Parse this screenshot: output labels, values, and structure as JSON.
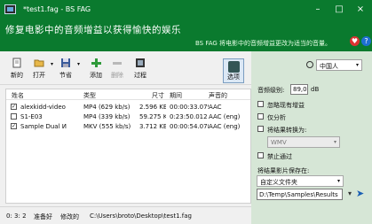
{
  "window": {
    "title": "*test1.fag - BS FAG",
    "slogan": "修复电影中的音频增益以获得愉快的娱乐",
    "hint": "BS FAG 将电影中的音频增益更改为适当的音量。",
    "controls": [
      "–",
      "□",
      "×"
    ]
  },
  "toolbar": {
    "buttons": [
      {
        "label": "新的",
        "icon": "new-file-icon"
      },
      {
        "label": "打开",
        "icon": "open-folder-icon"
      },
      {
        "label": "节省",
        "icon": "save-disk-icon"
      },
      {
        "label": "添加",
        "icon": "add-plus-icon"
      },
      {
        "label": "删除",
        "icon": "remove-minus-icon"
      },
      {
        "label": "过程",
        "icon": "process-film-icon"
      }
    ],
    "options_label": "选项"
  },
  "table": {
    "headers": [
      "姓名",
      "类型",
      "尺寸",
      "期间",
      "声音的"
    ],
    "rows": [
      {
        "checked": true,
        "name": "alexkidd-video",
        "type": "MP4 (629 kb/s)",
        "size": "2.596 KB",
        "duration": "00:00:33.079",
        "audio": "AAC"
      },
      {
        "checked": false,
        "name": "S1-E03",
        "type": "MP4 (339 kb/s)",
        "size": "59.275 KB",
        "duration": "0:23:50.012",
        "audio": "AAC (eng)"
      },
      {
        "checked": true,
        "name": "Sample Dual И",
        "type": "MKV (555 kb/s)",
        "size": "3.712 KB",
        "duration": "00:00:54.078",
        "audio": "AAC (eng)"
      }
    ]
  },
  "status": {
    "count": "0: 3: 2",
    "state": "准备好",
    "modified": "修改的",
    "file": "C:\\Users\\broto\\Desktop\\test1.fag"
  },
  "settings": {
    "language": "中国人",
    "gain_label": "音频级别:",
    "gain_value": "89,0",
    "gain_unit": "dB",
    "ignore_labels": [
      "忽略现有增益",
      "仅分析",
      "将结果转换为:",
      "禁止通过"
    ],
    "convert_format": "WMV",
    "unnamed_select": "",
    "save_to_label": "将结果影片保存在:",
    "save_to_option": "自定义文件夹",
    "output_path": "D:\\Temp\\Samples\\Results"
  },
  "colors": {
    "brand_green": "#0a7a2e",
    "panel_green": "#d6e6d6",
    "accent_blue": "#1a5fb4"
  }
}
